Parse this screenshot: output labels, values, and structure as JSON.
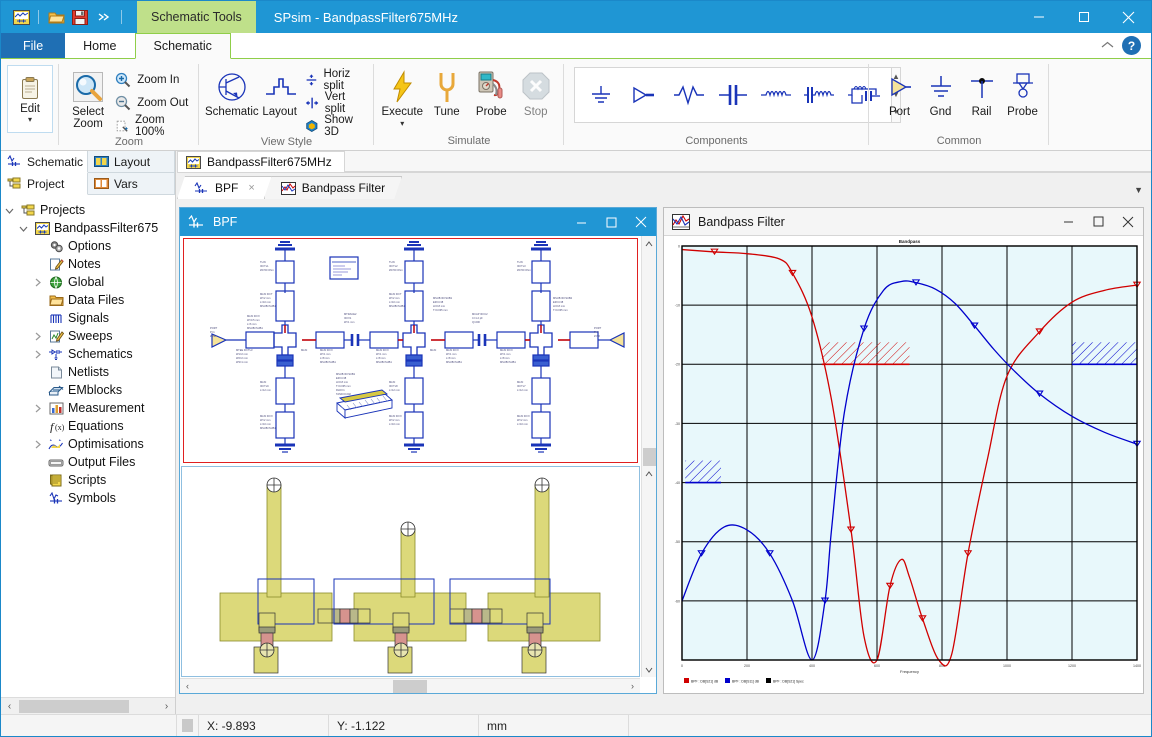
{
  "window": {
    "app_title": "SPsim - BandpassFilter675MHz",
    "context_tab": "Schematic Tools",
    "minimize": "—",
    "maximize": "☐",
    "close": "✕",
    "collapse_ribbon": "˄",
    "help": "?"
  },
  "quick_access": {
    "items": [
      {
        "name": "project-icon",
        "glyph": "project"
      },
      {
        "name": "open-icon",
        "glyph": "folder"
      },
      {
        "name": "save-icon",
        "glyph": "save"
      },
      {
        "name": "more-icon",
        "glyph": "more"
      }
    ]
  },
  "ribbon_tabs": [
    {
      "label": "File",
      "active": false
    },
    {
      "label": "Home",
      "active": false
    },
    {
      "label": "Schematic",
      "active": true
    }
  ],
  "ribbon": {
    "groups": [
      {
        "label": "",
        "buttons": [
          {
            "label": "Edit",
            "icon": "clipboard-icon",
            "has_caret": true
          }
        ]
      },
      {
        "label": "Zoom",
        "big": [
          {
            "label": "Select\nZoom",
            "label1": "Select",
            "label2": "Zoom",
            "icon": "magnifier-icon"
          }
        ],
        "small": [
          {
            "label": "Zoom In",
            "icon": "zoom-in-icon"
          },
          {
            "label": "Zoom Out",
            "icon": "zoom-out-icon"
          },
          {
            "label": "Zoom 100%",
            "icon": "zoom-100-icon"
          }
        ]
      },
      {
        "label": "View Style",
        "big": [
          {
            "label": "Schematic",
            "icon": "transistor-icon"
          },
          {
            "label": "Layout",
            "icon": "layout-icon"
          }
        ],
        "small": [
          {
            "label": "Horiz split",
            "icon": "horiz-split-icon"
          },
          {
            "label": "Vert split",
            "icon": "vert-split-icon"
          },
          {
            "label": "Show 3D",
            "icon": "show-3d-icon"
          }
        ]
      },
      {
        "label": "Simulate",
        "big": [
          {
            "label": "Execute",
            "icon": "lightning-icon",
            "has_caret": true
          },
          {
            "label": "Tune",
            "icon": "tuning-fork-icon"
          },
          {
            "label": "Probe",
            "icon": "multimeter-icon"
          },
          {
            "label": "Stop",
            "icon": "stop-icon",
            "disabled": true
          }
        ]
      },
      {
        "label": "Components",
        "items": [
          {
            "name": "gnd-symbol-icon"
          },
          {
            "name": "port-symbol-icon"
          },
          {
            "name": "source-symbol-icon"
          },
          {
            "name": "capacitor-symbol-icon"
          },
          {
            "name": "inductor-symbol-icon"
          },
          {
            "name": "rlc-symbol-icon"
          },
          {
            "name": "network-symbol-icon"
          }
        ],
        "scroll": {
          "up": "▲",
          "down": "▼",
          "more": "▼"
        }
      },
      {
        "label": "Common",
        "big": [
          {
            "label": "Port",
            "icon": "port-icon"
          },
          {
            "label": "Gnd",
            "icon": "gnd-icon"
          },
          {
            "label": "Rail",
            "icon": "rail-icon"
          },
          {
            "label": "Probe",
            "icon": "probe-icon"
          }
        ]
      }
    ]
  },
  "left_panel": {
    "tabs_top": [
      {
        "label": "Schematic",
        "icon": "schematic-icon",
        "active": true
      },
      {
        "label": "Layout",
        "icon": "layout-icon",
        "active": false
      }
    ],
    "tabs_bottom": [
      {
        "label": "Project",
        "icon": "project-icon",
        "active": true
      },
      {
        "label": "Vars",
        "icon": "vars-icon",
        "active": false
      }
    ],
    "tree": [
      {
        "label": "Projects",
        "depth": 0,
        "twist": "v",
        "icon": "project-root-icon"
      },
      {
        "label": "BandpassFilter675",
        "depth": 1,
        "twist": "v",
        "icon": "project-icon"
      },
      {
        "label": "Options",
        "depth": 2,
        "twist": "",
        "icon": "options-icon"
      },
      {
        "label": "Notes",
        "depth": 2,
        "twist": "",
        "icon": "notes-icon"
      },
      {
        "label": "Global",
        "depth": 2,
        "twist": ">",
        "icon": "global-icon"
      },
      {
        "label": "Data Files",
        "depth": 2,
        "twist": "",
        "icon": "datafiles-icon"
      },
      {
        "label": "Signals",
        "depth": 2,
        "twist": "",
        "icon": "signals-icon"
      },
      {
        "label": "Sweeps",
        "depth": 2,
        "twist": ">",
        "icon": "sweeps-icon"
      },
      {
        "label": "Schematics",
        "depth": 2,
        "twist": ">",
        "icon": "schematics-icon"
      },
      {
        "label": "Netlists",
        "depth": 2,
        "twist": "",
        "icon": "netlists-icon"
      },
      {
        "label": "EMblocks",
        "depth": 2,
        "twist": "",
        "icon": "emblocks-icon"
      },
      {
        "label": "Measurement",
        "depth": 2,
        "twist": ">",
        "icon": "measurement-icon"
      },
      {
        "label": "Equations",
        "depth": 2,
        "twist": "",
        "icon": "equations-icon"
      },
      {
        "label": "Optimisations",
        "depth": 2,
        "twist": ">",
        "icon": "optimisations-icon"
      },
      {
        "label": "Output Files",
        "depth": 2,
        "twist": "",
        "icon": "outputfiles-icon"
      },
      {
        "label": "Scripts",
        "depth": 2,
        "twist": "",
        "icon": "scripts-icon"
      },
      {
        "label": "Symbols",
        "depth": 2,
        "twist": "",
        "icon": "symbols-icon"
      }
    ],
    "hscroll": {
      "left": "‹",
      "right": "›"
    }
  },
  "document": {
    "doc_tab": {
      "label": "BandpassFilter675MHz",
      "icon": "project-icon"
    },
    "sub_tabs": [
      {
        "label": "BPF",
        "icon": "schematic-icon",
        "active": true,
        "closable": true,
        "close": "×"
      },
      {
        "label": "Bandpass Filter",
        "icon": "graph-icon",
        "active": false,
        "closable": false
      }
    ],
    "overflow_caret": "▼"
  },
  "schematic_window": {
    "title": "BPF",
    "icon": "schematic-icon",
    "active": true,
    "minimize": "—",
    "maximize": "☐",
    "close": "✕",
    "scroll_up": "˄",
    "scroll_down": "˅",
    "scroll_left": "‹",
    "scroll_right": "›"
  },
  "graph_window": {
    "title": "Bandpass Filter",
    "icon": "graph-icon",
    "active": false,
    "minimize": "—",
    "maximize": "☐",
    "close": "✕"
  },
  "chart_data": {
    "type": "line",
    "title": "Bandpass",
    "xlabel": "Frequency",
    "ylabel": "",
    "xlim": [
      0,
      1400
    ],
    "ylim": [
      -70,
      0
    ],
    "grid": true,
    "legend_position": "bottom-left",
    "xticks": [
      "0",
      "200",
      "400",
      "600",
      "800",
      "1000",
      "1200",
      "1400"
    ],
    "yticks": [
      "0",
      "-10",
      "-20",
      "-30",
      "-40",
      "-50",
      "-60",
      "-70"
    ],
    "series": [
      {
        "name": "BPF : DB[S21] dB",
        "color": "#d00000",
        "marker": "triangle-down",
        "x": [
          0,
          100,
          200,
          300,
          340,
          400,
          460,
          520,
          560,
          600,
          640,
          675,
          700,
          740,
          790,
          830,
          880,
          940,
          1000,
          1100,
          1200,
          1300,
          1400
        ],
        "y": [
          -0.6,
          -1.0,
          -1.3,
          -2.2,
          -4.6,
          -12,
          -26,
          -48,
          -66,
          -70,
          -57.5,
          -53,
          -56,
          -63,
          -70,
          -69,
          -52,
          -36,
          -22,
          -14.5,
          -9.5,
          -7.5,
          -6.6
        ]
      },
      {
        "name": "BPF : DB[S11] dB",
        "color": "#0000cc",
        "marker": "triangle-down",
        "x": [
          0,
          60,
          130,
          200,
          270,
          340,
          400,
          440,
          460,
          500,
          560,
          620,
          675,
          720,
          780,
          840,
          900,
          960,
          1020,
          1100,
          1200,
          1300,
          1400
        ],
        "y": [
          -60,
          -52,
          -47.5,
          -48,
          -52,
          -60,
          -70,
          -60,
          -48,
          -28,
          -14,
          -7.5,
          -6.0,
          -6.2,
          -7.3,
          -9.7,
          -13.5,
          -17.5,
          -21.0,
          -25.0,
          -28.8,
          -31.5,
          -33.5
        ]
      },
      {
        "name": "BPF : DB[S21] Spec",
        "color": "#000000",
        "marker": "none",
        "x": [],
        "y": []
      }
    ],
    "spec_regions": [
      {
        "name": "passband-spec-red",
        "color": "#d00000",
        "x0": 430,
        "x1": 700,
        "y": -20
      },
      {
        "name": "stopband-spec-blue-low",
        "color": "#0000cc",
        "x0": 10,
        "x1": 120,
        "y": -40
      },
      {
        "name": "stopband-spec-blue-high",
        "color": "#0000cc",
        "x0": 1200,
        "x1": 1400,
        "y": -20
      }
    ]
  },
  "status_bar": {
    "cells": [
      {
        "name": "status-message",
        "text": ""
      },
      {
        "name": "coord-x",
        "text": "X: -9.893"
      },
      {
        "name": "coord-y",
        "text": "Y: -1.122"
      },
      {
        "name": "units",
        "text": "mm"
      },
      {
        "name": "status-extra",
        "text": ""
      }
    ]
  },
  "colors": {
    "title_blue": "#1f96d4",
    "context_green": "#bfe08a",
    "accent_green": "#8fce49",
    "file_blue": "#1f6fb4",
    "schematic_blue": "#0000cc",
    "schematic_red": "#cc0000",
    "layout_yellow": "#dcd97a",
    "layout_pink": "#d6938e"
  }
}
